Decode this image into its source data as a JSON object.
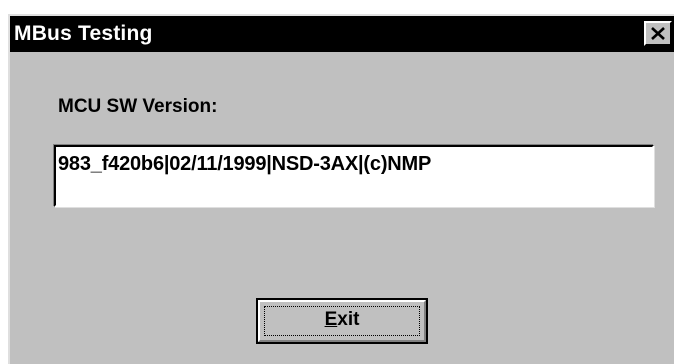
{
  "window": {
    "title": "MBus Testing",
    "close_icon": "close-icon"
  },
  "main": {
    "label": "MCU SW Version:",
    "version_value": "983_f420b6|02/11/1999|NSD-3AX|(c)NMP"
  },
  "exit_button": {
    "mnemonic": "E",
    "rest": "xit"
  },
  "colors": {
    "title_bar": "#000000",
    "title_text": "#ffffff",
    "dialog_face": "#c0c0c0",
    "field_bg": "#ffffff"
  }
}
